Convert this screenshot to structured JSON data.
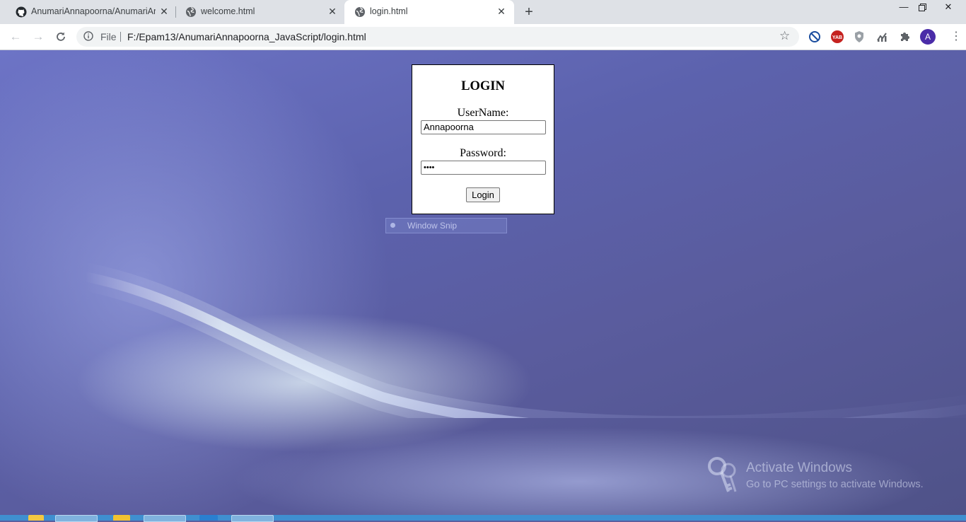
{
  "tabs": [
    {
      "title": "AnumariAnnapoorna/AnumariAn",
      "icon": "github-icon",
      "active": false
    },
    {
      "title": "welcome.html",
      "icon": "globe-icon",
      "active": false
    },
    {
      "title": "login.html",
      "icon": "globe-icon",
      "active": true
    }
  ],
  "toolbar": {
    "scheme_label": "File",
    "url": "F:/Epam13/AnumariAnnapoorna_JavaScript/login.html",
    "avatar_initial": "A",
    "extension_yab_label": "YAB"
  },
  "login": {
    "title": "LOGIN",
    "username_label": "UserName:",
    "username_value": "Annapoorna",
    "password_label": "Password:",
    "password_value": "••••",
    "button_label": "Login"
  },
  "overlay": {
    "snip_label": "Window Snip",
    "activate_heading": "Activate Windows",
    "activate_sub": "Go to PC settings to activate Windows."
  },
  "colors": {
    "tabstrip_bg": "#dee1e6",
    "avatar_bg": "#4a2ca8",
    "yab_red": "#c5221f",
    "taskbar": "#3f8fd0"
  }
}
